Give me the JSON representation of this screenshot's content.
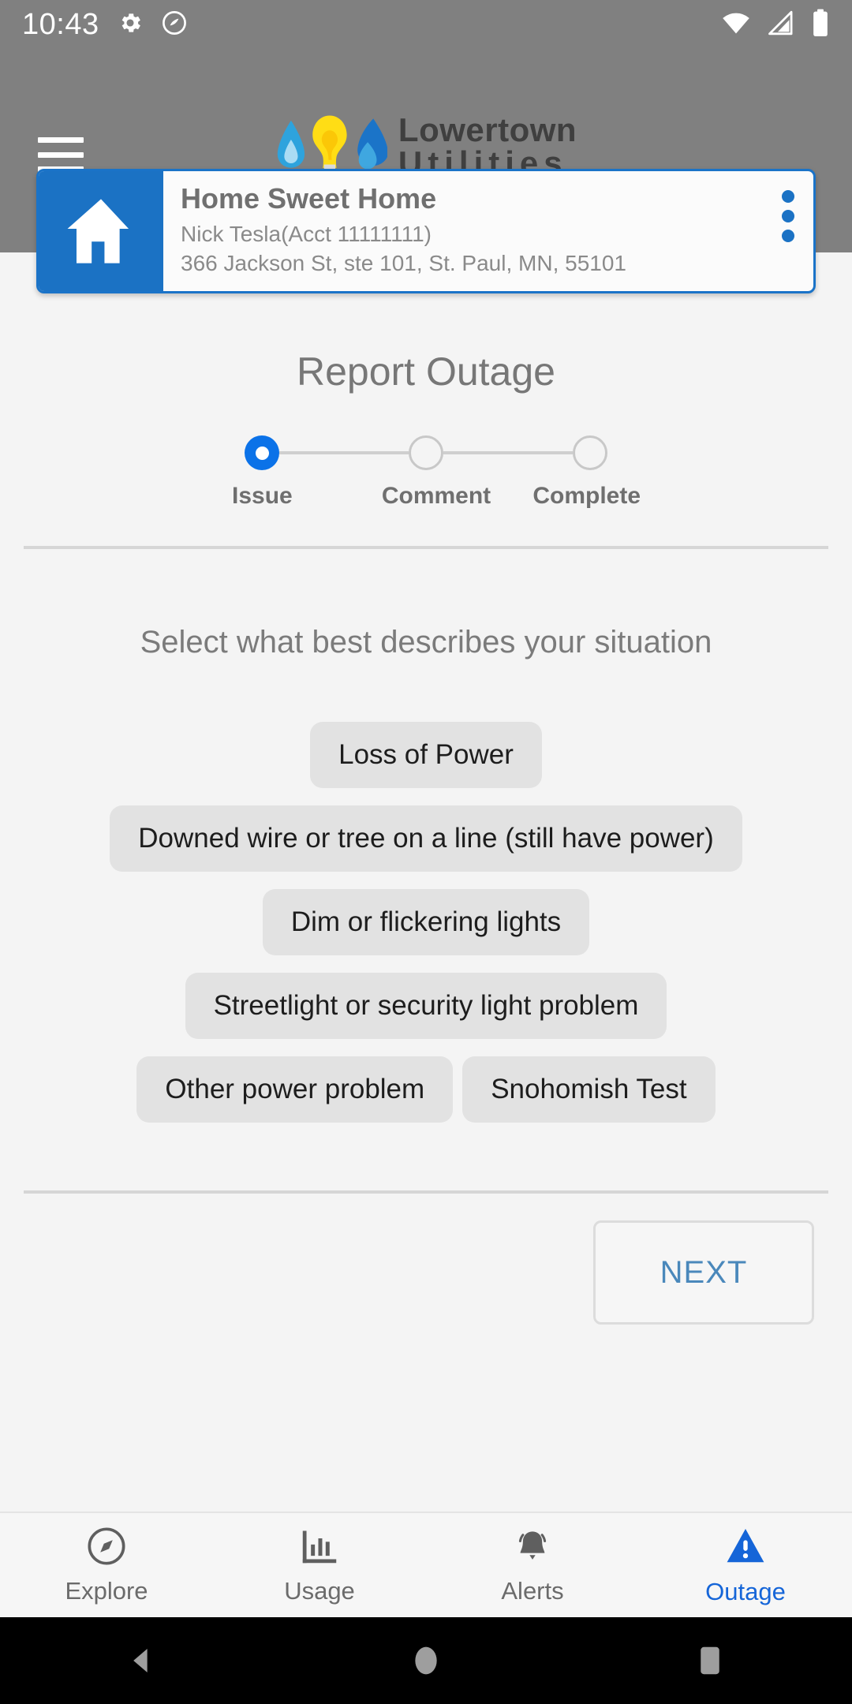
{
  "status_bar": {
    "time": "10:43",
    "icons": [
      "settings-gear-icon",
      "do-not-disturb-icon",
      "wifi-icon",
      "cellular-signal-icon",
      "battery-icon"
    ]
  },
  "header": {
    "menu_icon": "hamburger-menu-icon",
    "brand_line1": "Lowertown",
    "brand_line2": "Utilities",
    "logo_marks": [
      "water-drop-icon",
      "light-bulb-icon",
      "gas-flame-icon"
    ],
    "background_color": "#808080"
  },
  "account_card": {
    "icon": "home-icon",
    "title": "Home Sweet Home",
    "customer": "Nick Tesla(Acct 11111111)",
    "address": "366 Jackson St, ste 101, St. Paul, MN, 55101",
    "overflow_icon": "kebab-menu-icon",
    "accent_color": "#1b72c4"
  },
  "main": {
    "page_title": "Report Outage",
    "prompt": "Select what best describes your situation",
    "stepper": {
      "steps": [
        {
          "label": "Issue",
          "state": "active"
        },
        {
          "label": "Comment",
          "state": "idle"
        },
        {
          "label": "Complete",
          "state": "idle"
        }
      ],
      "active_color": "#0b72e8"
    },
    "issue_options": [
      {
        "label": "Loss of Power"
      },
      {
        "label": "Downed wire or tree on a line (still have power)"
      },
      {
        "label": "Dim or flickering lights"
      },
      {
        "label": "Streetlight or security light problem"
      },
      {
        "label": "Other power problem"
      },
      {
        "label": "Snohomish Test"
      }
    ],
    "next_label": "NEXT",
    "next_color": "#4a88bb"
  },
  "bottom_nav": {
    "items": [
      {
        "label": "Explore",
        "icon": "compass-icon",
        "active": false
      },
      {
        "label": "Usage",
        "icon": "bar-chart-icon",
        "active": false
      },
      {
        "label": "Alerts",
        "icon": "bell-icon",
        "active": false
      },
      {
        "label": "Outage",
        "icon": "warning-triangle-icon",
        "active": true
      }
    ],
    "active_color": "#1565d8"
  },
  "system_bar": {
    "back": "back-triangle-icon",
    "home": "home-circle-icon",
    "recents": "recents-square-icon"
  }
}
